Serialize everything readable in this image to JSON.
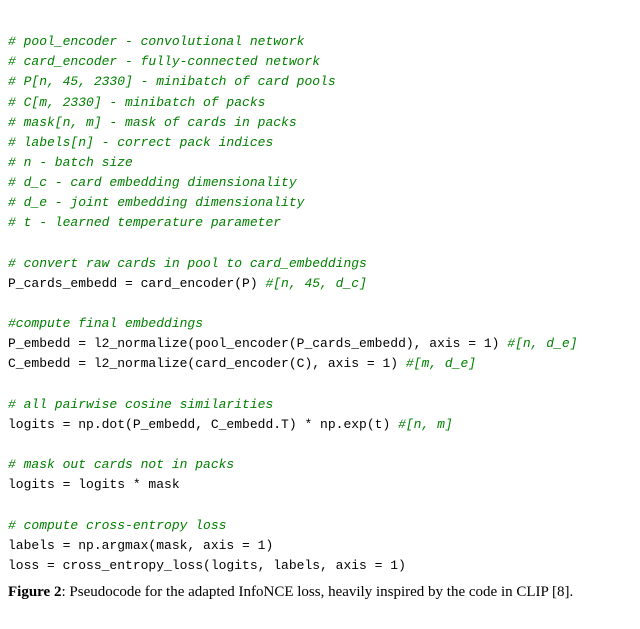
{
  "code": {
    "c_pool_encoder": "# pool_encoder - convolutional network",
    "c_card_encoder": "# card_encoder - fully-connected network",
    "c_P": "# P[n, 45, 2330] - minibatch of card pools",
    "c_C": "# C[m, 2330] - minibatch of packs",
    "c_mask": "# mask[n, m] - mask of cards in packs",
    "c_labels": "# labels[n] - correct pack indices",
    "c_n": "# n - batch size",
    "c_dc": "# d_c - card embedding dimensionality",
    "c_de": "# d_e - joint embedding dimensionality",
    "c_t": "# t - learned temperature parameter",
    "c_convert": "# convert raw cards in pool to card_embeddings",
    "l_p_cards_embedd": "P_cards_embedd = card_encoder(P) ",
    "tc_p_cards_dim": "#[n, 45, d_c]",
    "c_compute_final": "#compute final embeddings",
    "l_p_embedd": "P_embedd = l2_normalize(pool_encoder(P_cards_embedd), axis = 1) ",
    "tc_p_embedd_dim": "#[n, d_e]",
    "l_c_embedd": "C_embedd = l2_normalize(card_encoder(C), axis = 1) ",
    "tc_c_embedd_dim": "#[m, d_e]",
    "c_pairwise": "# all pairwise cosine similarities",
    "l_logits": "logits = np.dot(P_embedd, C_embedd.T) * np.exp(t) ",
    "tc_logits_dim": "#[n, m]",
    "c_mask_out": "# mask out cards not in packs",
    "l_logits_mask": "logits = logits * mask",
    "c_ce_loss": "# compute cross-entropy loss",
    "l_labels": "labels = np.argmax(mask, axis = 1)",
    "l_loss": "loss = cross_entropy_loss(logits, labels, axis = 1)"
  },
  "caption": {
    "label": "Figure 2",
    "text": ": Pseudocode for the adapted InfoNCE loss, heavily inspired by the code in CLIP [8]."
  }
}
